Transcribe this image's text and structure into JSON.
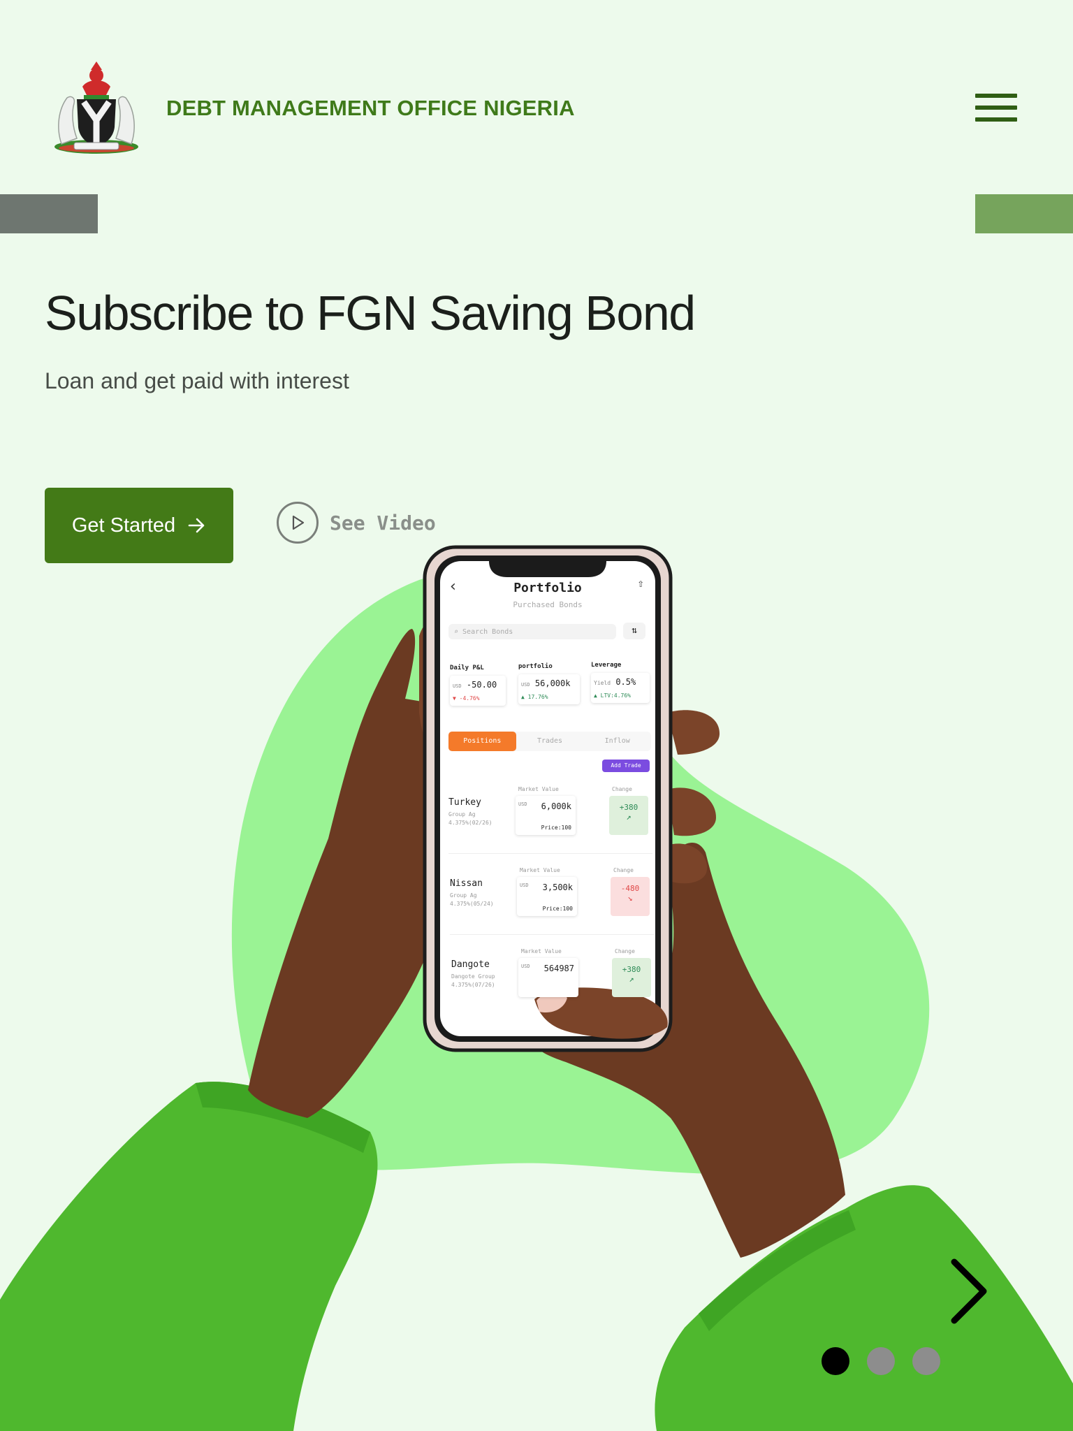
{
  "header": {
    "brand": "DEBT MANAGEMENT OFFICE NIGERIA",
    "logo_icon": "nigeria-coat-of-arms-icon",
    "menu_icon": "hamburger-menu-icon"
  },
  "hero": {
    "title": "Subscribe to FGN Saving Bond",
    "subtitle": "Loan and get paid with interest",
    "cta_label": "Get Started",
    "video_label": "See Video"
  },
  "phone": {
    "title": "Portfolio",
    "subtitle": "Purchased Bonds",
    "search_placeholder": "Search Bonds",
    "stats": [
      {
        "label": "Daily P&L",
        "unit": "USD",
        "value": "-50.00",
        "delta": "▼ -4.76%",
        "dir": "down"
      },
      {
        "label": "portfolio",
        "unit": "USD",
        "value": "56,000k",
        "delta": "▲ 17.76%",
        "dir": "up"
      },
      {
        "label": "Leverage",
        "prefix": "Yield",
        "value": "0.5%",
        "delta": "▲ LTV:4.76%",
        "dir": "up"
      }
    ],
    "tabs": [
      "Positions",
      "Trades",
      "Inflow"
    ],
    "add_trade": "Add Trade",
    "rows": [
      {
        "name": "Turkey",
        "group": "Group Ag",
        "rate": "4.375%(02/26)",
        "mv_label": "Market Value",
        "unit": "USD",
        "value": "6,000k",
        "price": "Price:100",
        "change_label": "Change",
        "change": "+380",
        "dir": "up"
      },
      {
        "name": "Nissan",
        "group": "Group Ag",
        "rate": "4.375%(05/24)",
        "mv_label": "Market Value",
        "unit": "USD",
        "value": "3,500k",
        "price": "Price:100",
        "change_label": "Change",
        "change": "-480",
        "dir": "down"
      },
      {
        "name": "Dangote",
        "group": "Dangote Group",
        "rate": "4.375%(07/26)",
        "mv_label": "Market Value",
        "unit": "USD",
        "value": "564987",
        "price": "",
        "change_label": "Change",
        "change": "+380",
        "dir": "up"
      }
    ]
  },
  "carousel": {
    "next_icon": "chevron-right-icon",
    "active_index": 0,
    "dot_count": 3
  },
  "colors": {
    "background": "#edfaec",
    "brand": "#3f7a1a",
    "button": "#437a17",
    "blob": "#9af394",
    "sleeve": "#4fb82e",
    "positive": "#2e8b57",
    "negative": "#e04848",
    "tab_active": "#f47a2a",
    "add_trade": "#7b4ce0"
  }
}
